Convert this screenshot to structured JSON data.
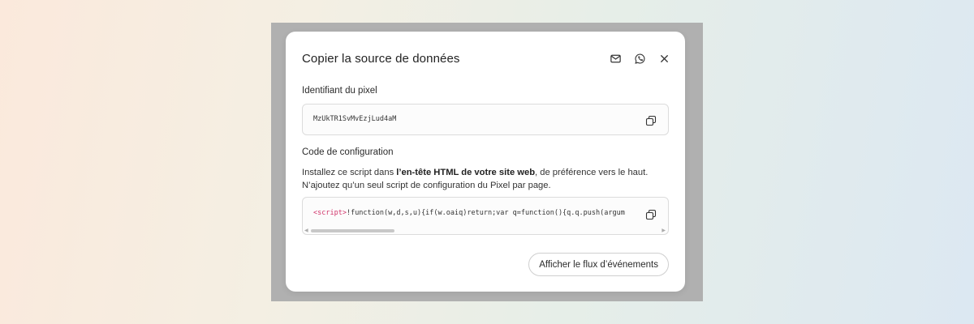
{
  "dialog": {
    "title": "Copier la source de données",
    "header_icons": [
      "mail-icon",
      "whatsapp-icon",
      "close-icon"
    ]
  },
  "pixel_id": {
    "label": "Identifiant du pixel",
    "value": "MzUkTR1SvMvEzjLud4aM",
    "copy_icon": "copy-icon"
  },
  "config": {
    "label": "Code de configuration",
    "desc_part1": "Installez ce script dans ",
    "desc_bold": "l’en-tête HTML de votre site web",
    "desc_part2": ", de préférence vers le haut.",
    "desc_line2": "N’ajoutez qu’un seul script de configuration du Pixel par page.",
    "code_tag": "<script>",
    "code_rest": "!function(w,d,s,u){if(w.oaiq)return;var q=function(){q.q.push(argum",
    "copy_icon": "copy-icon"
  },
  "footer": {
    "button_label": "Afficher le flux d’événements"
  },
  "colors": {
    "overlay": "#b0b0b0",
    "code_tag": "#d1346a"
  }
}
